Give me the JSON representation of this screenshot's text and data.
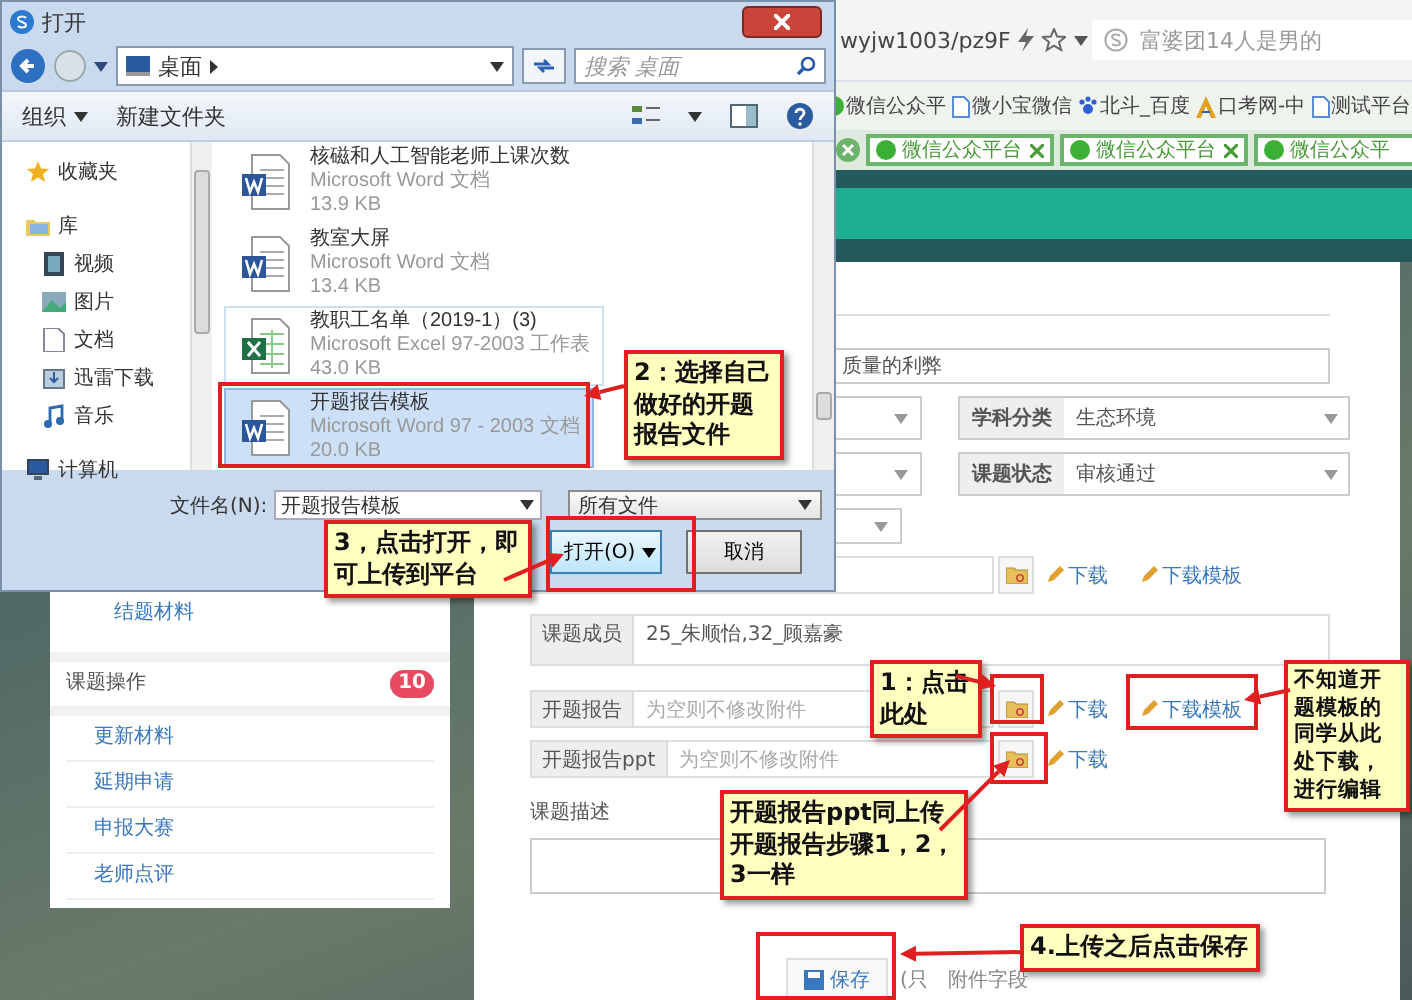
{
  "browser": {
    "address": "wyjw1003/pz9F",
    "search": "富婆团14人是男的",
    "bookmarks": [
      {
        "label": "微信公众平",
        "kind": "wechat"
      },
      {
        "label": "微小宝微信",
        "kind": "page"
      },
      {
        "label": "北斗_百度",
        "kind": "paw"
      },
      {
        "label": "口考网-中",
        "kind": "letter"
      },
      {
        "label": "测试平台",
        "kind": "page"
      }
    ],
    "tabs": [
      {
        "label": "微信公众平台"
      },
      {
        "label": "微信公众平台"
      },
      {
        "label": "微信公众平"
      }
    ]
  },
  "sidebar": {
    "items": [
      {
        "label": "结题材料",
        "kind": "link"
      },
      {
        "label": "课题操作",
        "kind": "header",
        "badge": "10"
      },
      {
        "label": "更新材料",
        "kind": "link"
      },
      {
        "label": "延期申请",
        "kind": "link"
      },
      {
        "label": "申报大赛",
        "kind": "link"
      },
      {
        "label": "老师点评",
        "kind": "link"
      }
    ]
  },
  "form": {
    "title_value": "质量的利弊",
    "selects": [
      {
        "label": "学科分类",
        "value": "生态环境"
      },
      {
        "label": "课题状态",
        "value": "审核通过"
      }
    ],
    "members": {
      "label": "课题成员",
      "value": "25_朱顺怡,32_顾嘉豪"
    },
    "uploads": [
      {
        "download": "下载",
        "template": "下载模板"
      },
      {
        "label": "开题报告",
        "placeholder": "为空则不修改附件",
        "download": "下载",
        "template": "下载模板"
      },
      {
        "label": "开题报告ppt",
        "placeholder": "为空则不修改附件",
        "download": "下载"
      }
    ],
    "description_label": "课题描述",
    "save": "保存",
    "note_start": "(只",
    "note_end": "附件字段"
  },
  "dialog": {
    "title": "打开",
    "path": "桌面",
    "search_placeholder": "搜索 桌面",
    "organize": "组织",
    "new_folder": "新建文件夹",
    "nav": [
      {
        "label": "收藏夹",
        "kind": "star"
      },
      {
        "label": "库",
        "kind": "library",
        "children": [
          {
            "label": "视频",
            "kind": "video"
          },
          {
            "label": "图片",
            "kind": "picture"
          },
          {
            "label": "文档",
            "kind": "document"
          },
          {
            "label": "迅雷下载",
            "kind": "download"
          },
          {
            "label": "音乐",
            "kind": "music"
          }
        ]
      },
      {
        "label": "计算机",
        "kind": "computer"
      }
    ],
    "files": [
      {
        "name": "核磁和人工智能老师上课次数",
        "type": "Microsoft Word 文档",
        "size": "13.9 KB",
        "kind": "word",
        "selected": false
      },
      {
        "name": "教室大屏",
        "type": "Microsoft Word 文档",
        "size": "13.4 KB",
        "kind": "word",
        "selected": false
      },
      {
        "name": "教职工名单（2019-1）(3)",
        "type": "Microsoft Excel 97-2003 工作表",
        "size": "43.0 KB",
        "kind": "excel",
        "selected": false
      },
      {
        "name": "开题报告模板",
        "type": "Microsoft Word 97 - 2003 文档",
        "size": "20.0 KB",
        "kind": "word",
        "selected": true
      }
    ],
    "filename_label": "文件名(N):",
    "filename": "开题报告模板",
    "filter": "所有文件",
    "open": "打开(O)",
    "cancel": "取消"
  },
  "callouts": [
    {
      "text": "2：选择自己做好的开题报告文件"
    },
    {
      "text": "3，点击打开，即可上传到平台"
    },
    {
      "text": "1：点击此处"
    },
    {
      "text": "开题报告ppt同上传开题报告步骤1，2，3一样"
    },
    {
      "text": "不知道开题模板的同学从此处下载，进行编辑"
    },
    {
      "text": "4.上传之后点击保存"
    }
  ]
}
